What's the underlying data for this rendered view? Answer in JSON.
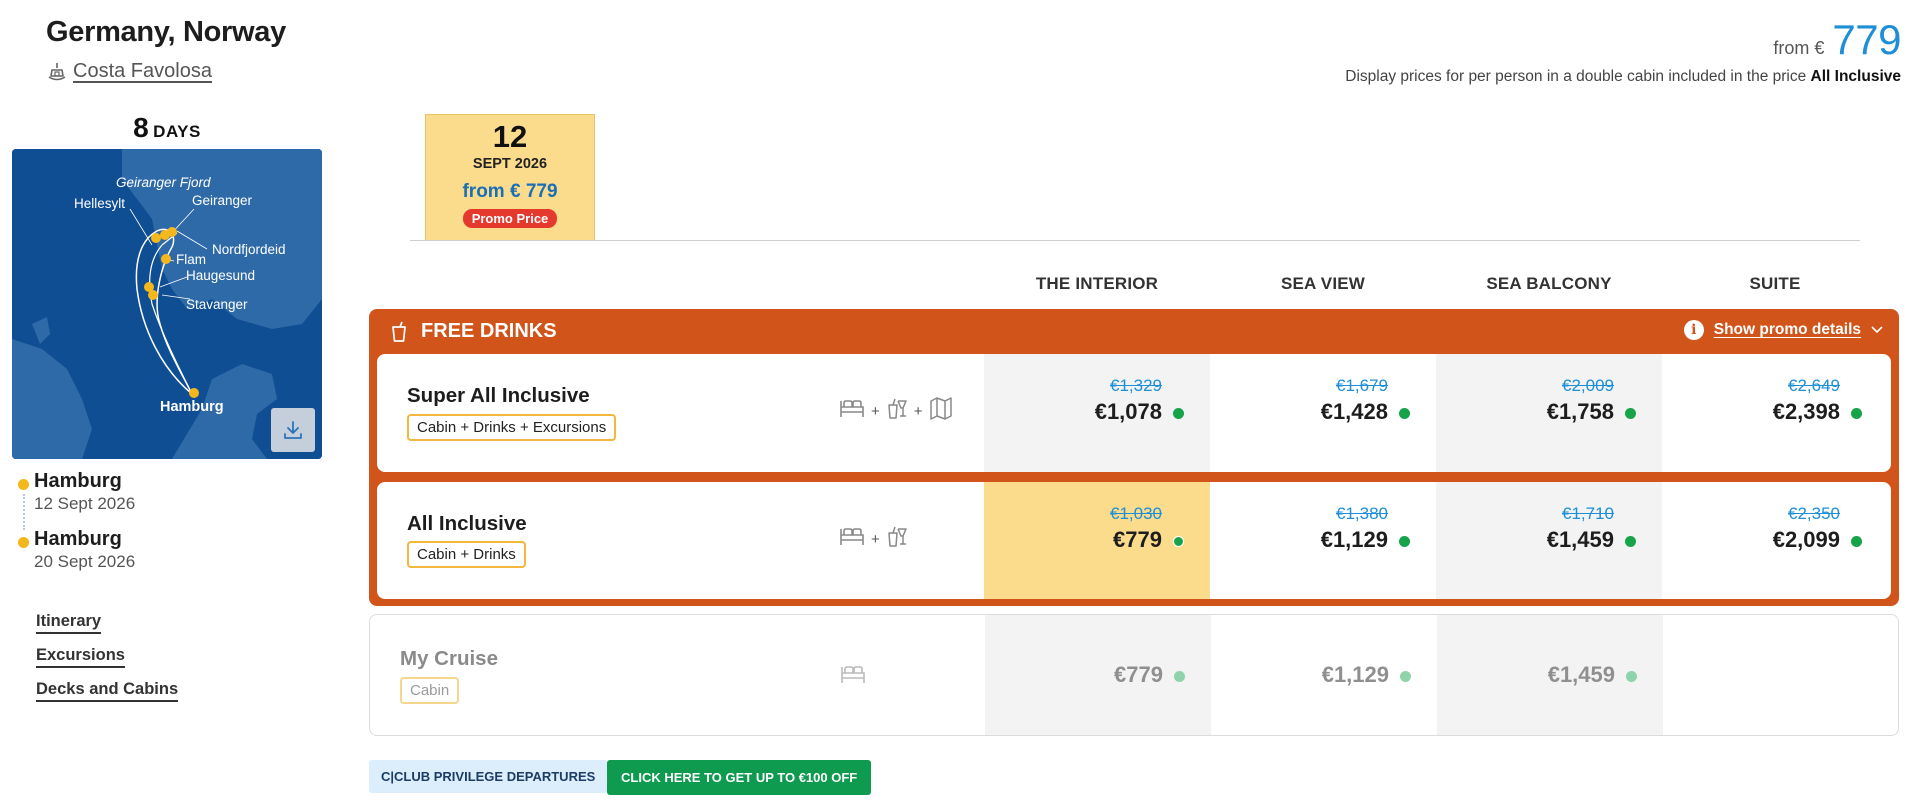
{
  "header": {
    "title": "Germany, Norway",
    "ship_name": "Costa Favolosa",
    "from_label": "from €",
    "from_price": "779",
    "price_note": "Display prices for per person in a double cabin included in the price",
    "price_note_bold": "All Inclusive"
  },
  "trip": {
    "days_num": "8",
    "days_unit": "DAYS"
  },
  "map": {
    "labels": {
      "fjord": "Geiranger Fjord",
      "hellesylt": "Hellesylt",
      "geiranger": "Geiranger",
      "nordfjordeid": "Nordfjordeid",
      "flam": "Flam",
      "haugesund": "Haugesund",
      "stavanger": "Stavanger",
      "hamburg": "Hamburg"
    },
    "colors": {
      "sea": "#0f4e93",
      "land": "#2f6aa8",
      "route": "#ffffff",
      "port": "#f5b81c"
    }
  },
  "stops": [
    {
      "port": "Hamburg",
      "date": "12 Sept 2026"
    },
    {
      "port": "Hamburg",
      "date": "20 Sept 2026"
    }
  ],
  "side_links": [
    "Itinerary",
    "Excursions",
    "Decks and Cabins"
  ],
  "date_tab": {
    "day": "12",
    "month": "SEPT 2026",
    "from": "from € 779",
    "badge": "Promo Price"
  },
  "columns": [
    "THE INTERIOR",
    "SEA VIEW",
    "SEA BALCONY",
    "SUITE"
  ],
  "promo": {
    "title": "FREE DRINKS",
    "details_link": "Show promo details"
  },
  "packages": [
    {
      "name": "Super All Inclusive",
      "tag": "Cabin + Drinks + Excursions",
      "icons": [
        "bed-icon",
        "drinks-icon",
        "map-icon"
      ],
      "plus": [
        "+",
        "+"
      ],
      "prices": [
        {
          "old": "€1,329",
          "new": "€1,078"
        },
        {
          "old": "€1,679",
          "new": "€1,428"
        },
        {
          "old": "€2,009",
          "new": "€1,758"
        },
        {
          "old": "€2,649",
          "new": "€2,398"
        }
      ]
    },
    {
      "name": "All Inclusive",
      "tag": "Cabin + Drinks",
      "icons": [
        "bed-icon",
        "drinks-icon"
      ],
      "plus": [
        "+"
      ],
      "prices": [
        {
          "old": "€1,030",
          "new": "€779"
        },
        {
          "old": "€1,380",
          "new": "€1,129"
        },
        {
          "old": "€1,710",
          "new": "€1,459"
        },
        {
          "old": "€2,350",
          "new": "€2,099"
        }
      ]
    },
    {
      "name": "My Cruise",
      "tag": "Cabin",
      "icons": [
        "bed-icon"
      ],
      "prices": [
        {
          "new": "€779"
        },
        {
          "new": "€1,129"
        },
        {
          "new": "€1,459"
        }
      ]
    }
  ],
  "buttons": {
    "club": "C|CLUB PRIVILEGE DEPARTURES",
    "offer": "CLICK HERE TO GET UP TO €100 OFF"
  },
  "colors": {
    "accent_blue": "#1e8fd6",
    "promo_orange": "#d1541a",
    "highlight_yellow": "#fbdc8c",
    "availability_green": "#16a34a",
    "badge_red": "#e6392d",
    "offer_green": "#0e9a4f"
  }
}
